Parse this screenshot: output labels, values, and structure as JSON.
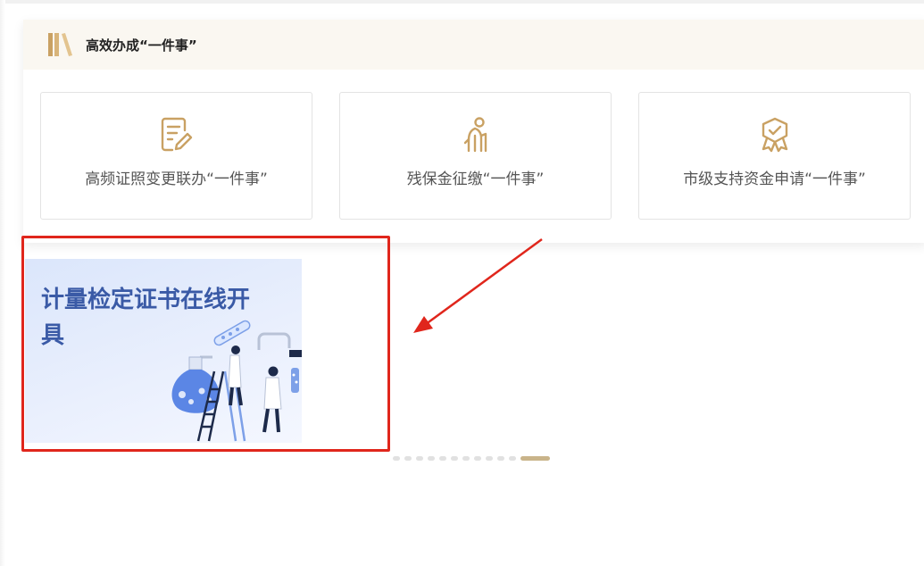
{
  "section": {
    "title": "高效办成“一件事”",
    "icon": "books-icon",
    "accent_color": "#c9a163"
  },
  "cards": [
    {
      "label": "高频证照变更联办“一件事”",
      "icon": "document-edit-icon"
    },
    {
      "label": "残保金征缴“一件事”",
      "icon": "elderly-person-icon"
    },
    {
      "label": "市级支持资金申请“一件事”",
      "icon": "award-badge-icon"
    }
  ],
  "banner": {
    "title": "计量检定证书在线开具",
    "highlight_color": "#e0261c",
    "icon": "laboratory-illustration"
  },
  "annotation": {
    "icon": "red-arrow-icon",
    "color": "#e0261c"
  },
  "carousel": {
    "dot_count": 12,
    "active_index": 11,
    "active_color": "#c9b48a"
  }
}
